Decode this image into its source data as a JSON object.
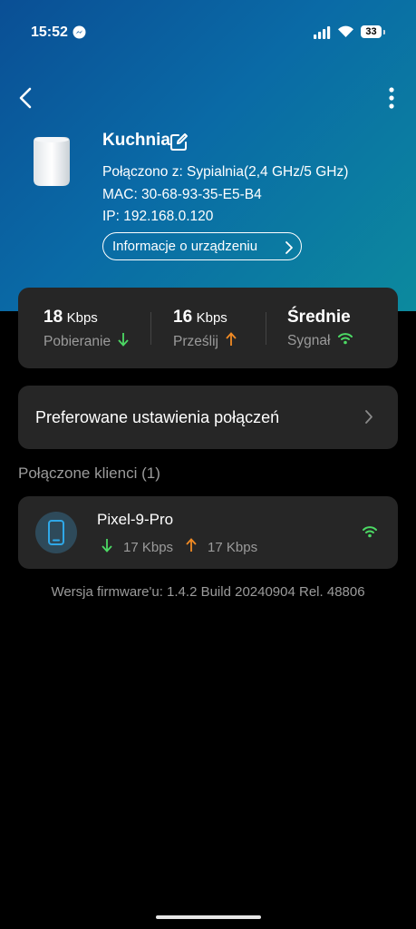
{
  "status_bar": {
    "time": "15:52",
    "battery": "33",
    "messenger_icon": "messenger-icon",
    "signal_icon": "cellular-signal-icon",
    "wifi_icon": "wifi-icon"
  },
  "header": {
    "back_icon": "back-arrow-icon",
    "more_icon": "more-vertical-icon"
  },
  "device": {
    "name": "Kuchnia",
    "connected_to": "Połączono z: Sypialnia(2,4 GHz/5 GHz)",
    "mac": "MAC: 30-68-93-35-E5-B4",
    "ip": "IP: 192.168.0.120",
    "info_button": "Informacje o urządzeniu"
  },
  "stats": {
    "download_value": "18",
    "download_unit": "Kbps",
    "download_label": "Pobieranie",
    "upload_value": "16",
    "upload_unit": "Kbps",
    "upload_label": "Prześlij",
    "signal_value": "Średnie",
    "signal_label": "Sygnał"
  },
  "preferences": {
    "label": "Preferowane ustawienia połączeń"
  },
  "clients": {
    "section_title": "Połączone klienci (1)",
    "items": [
      {
        "name": "Pixel-9-Pro",
        "download": "17 Kbps",
        "upload": "17 Kbps"
      }
    ]
  },
  "firmware": "Wersja firmware'u: 1.4.2 Build 20240904 Rel. 48806",
  "colors": {
    "accent_green": "#4cd964",
    "accent_orange": "#f08a24",
    "card_bg": "#262626"
  }
}
